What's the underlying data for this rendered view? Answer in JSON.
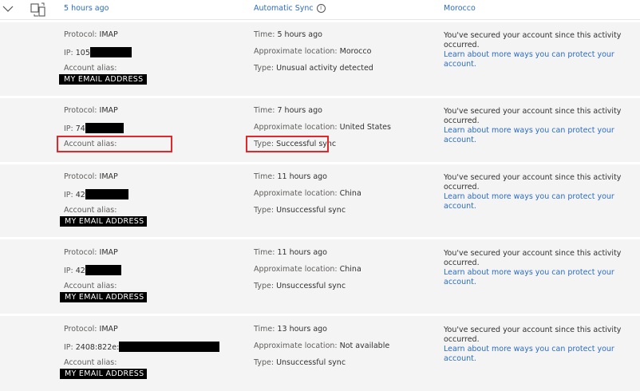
{
  "header": {
    "time": "5 hours ago",
    "app": "Automatic Sync",
    "info_icon": "i",
    "location": "Morocco"
  },
  "labels": {
    "protocol": "Protocol:",
    "ip": "IP:",
    "alias": "Account alias:",
    "time": "Time:",
    "location": "Approximate location:",
    "type": "Type:"
  },
  "message": {
    "secured": "You've secured your account since this activity occurred.",
    "learn_more": "Learn about more ways you can protect your account."
  },
  "rows": [
    {
      "protocol": "IMAP",
      "ip": "105",
      "alias": "MY EMAIL ADDRESS",
      "time": "5 hours ago",
      "location": "Morocco",
      "type": "Unusual activity detected"
    },
    {
      "protocol": "IMAP",
      "ip": "74",
      "alias": "",
      "time": "7 hours ago",
      "location": "United States",
      "type": "Successful sync"
    },
    {
      "protocol": "IMAP",
      "ip": "42",
      "alias": "MY EMAIL ADDRESS",
      "time": "11 hours ago",
      "location": "China",
      "type": "Unsuccessful sync"
    },
    {
      "protocol": "IMAP",
      "ip": "42",
      "alias": "MY EMAIL ADDRESS",
      "time": "11 hours ago",
      "location": "China",
      "type": "Unsuccessful sync"
    },
    {
      "protocol": "IMAP",
      "ip": "2408:822e:",
      "alias": "MY EMAIL ADDRESS",
      "time": "13 hours ago",
      "location": "Not available",
      "type": "Unsuccessful sync"
    }
  ],
  "colors": {
    "link": "#2b6cc4",
    "highlight": "#e3262a",
    "redaction": "#000000"
  }
}
